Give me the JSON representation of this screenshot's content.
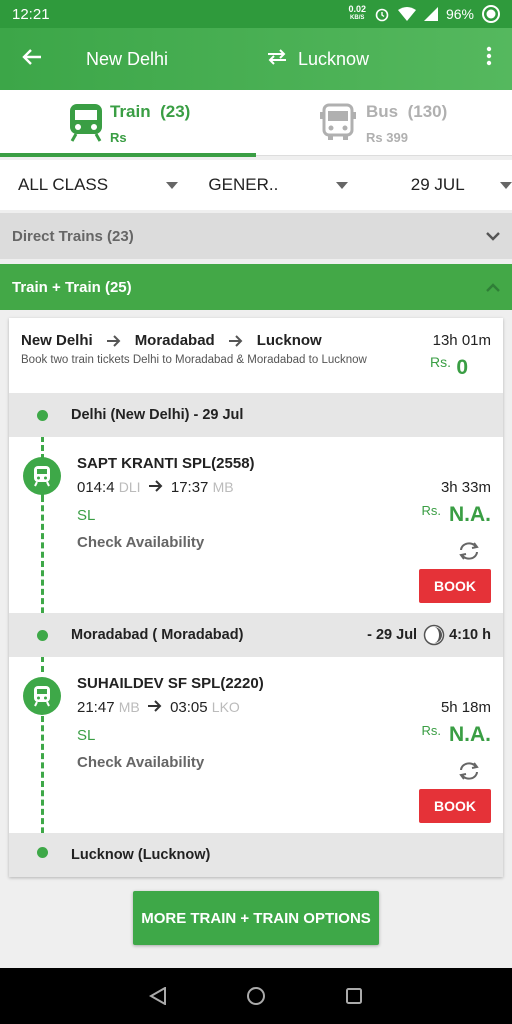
{
  "status": {
    "time": "12:21",
    "speed": "0.02",
    "speed_unit": "KB/S",
    "battery": "96%"
  },
  "appbar": {
    "from": "New Delhi",
    "to": "Lucknow"
  },
  "tabs": [
    {
      "name": "Train",
      "count": "(23)",
      "price": "Rs"
    },
    {
      "name": "Bus",
      "count": "(130)",
      "price": "Rs 399"
    }
  ],
  "filters": {
    "class": "ALL CLASS",
    "quota": "GENER..",
    "date": "29 JUL"
  },
  "sections": {
    "direct": "Direct Trains  (23)",
    "combo": "Train + Train  (25)"
  },
  "card": {
    "route": [
      "New Delhi",
      "Moradabad",
      "Lucknow"
    ],
    "description": "Book two train tickets Delhi to Moradabad & Moradabad to Lucknow",
    "duration": "13h 01m",
    "price_label": "Rs.",
    "price_value": "0",
    "stops": [
      {
        "name": "Delhi (New Delhi) - 29 Jul"
      },
      {
        "name": "Moradabad ( Moradabad)",
        "date": "- 29 Jul",
        "wait": "4:10 h"
      },
      {
        "name": "Lucknow (Lucknow)"
      }
    ],
    "trains": [
      {
        "name": "SAPT KRANTI SPL(2558)",
        "dep": "014:4",
        "dep_code": "DLI",
        "arr": "17:37",
        "arr_code": "MB",
        "duration": "3h 33m",
        "class": "SL",
        "price_label": "Rs.",
        "price": "N.A.",
        "check": "Check Availability",
        "book": "BOOK"
      },
      {
        "name": "SUHAILDEV SF SPL(2220)",
        "dep": "21:47",
        "dep_code": "MB",
        "arr": "03:05",
        "arr_code": "LKO",
        "duration": "5h 18m",
        "class": "SL",
        "price_label": "Rs.",
        "price": "N.A.",
        "check": "Check Availability",
        "book": "BOOK"
      }
    ]
  },
  "more_button": "MORE TRAIN + TRAIN OPTIONS",
  "colors": {
    "primary": "#3ea848",
    "book": "#e53238"
  }
}
